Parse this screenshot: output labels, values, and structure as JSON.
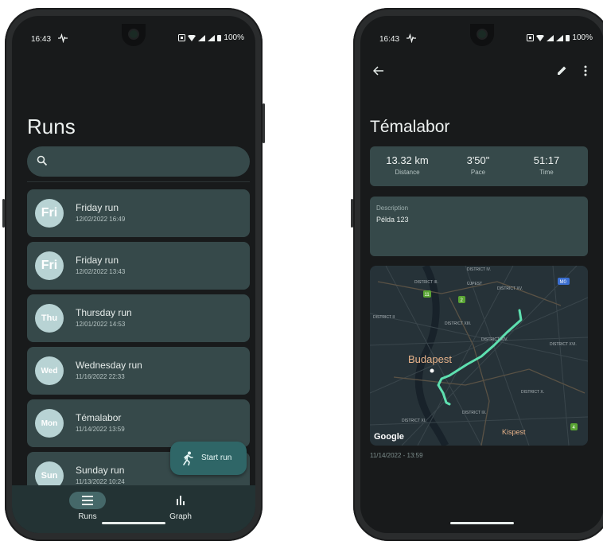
{
  "status_bar": {
    "time": "16:43",
    "battery": "100%"
  },
  "runs_screen": {
    "title": "Runs",
    "runs": [
      {
        "day": "Fri",
        "name": "Friday run",
        "date": "12/02/2022 16:49"
      },
      {
        "day": "Fri",
        "name": "Friday run",
        "date": "12/02/2022 13:43"
      },
      {
        "day": "Thu",
        "name": "Thursday run",
        "date": "12/01/2022 14:53"
      },
      {
        "day": "Wed",
        "name": "Wednesday run",
        "date": "11/16/2022 22:33"
      },
      {
        "day": "Mon",
        "name": "Témalabor",
        "date": "11/14/2022 13:59"
      },
      {
        "day": "Sun",
        "name": "Sunday run",
        "date": "11/13/2022 10:24"
      }
    ],
    "fab_label": "Start run",
    "nav": [
      {
        "label": "Runs",
        "icon": "list-icon",
        "active": true
      },
      {
        "label": "Graph",
        "icon": "bar-chart-icon",
        "active": false
      }
    ]
  },
  "detail_screen": {
    "title": "Témalabor",
    "stats": [
      {
        "value": "13.32 km",
        "label": "Distance"
      },
      {
        "value": "3'50\"",
        "label": "Pace"
      },
      {
        "value": "51:17",
        "label": "Time"
      }
    ],
    "description_label": "Description",
    "description_value": "Példa 123",
    "map": {
      "city_label": "Budapest",
      "districts": [
        "DISTRICT IV.",
        "DISTRICT III.",
        "ÚJPEST",
        "DISTRICT XV.",
        "DISTRICT II",
        "DISTRICT XIII.",
        "DISTRICT XIV.",
        "DISTRICT XVI.",
        "DISTRICT X.",
        "DISTRICT IX.",
        "DISTRICT XI.",
        "Kispest"
      ],
      "route_badges": [
        "M0",
        "11",
        "2",
        "4"
      ],
      "attribution": "Google"
    },
    "date_range": "11/14/2022 - 13:59"
  },
  "colors": {
    "background": "#181a1b",
    "card": "#36494a",
    "accent": "#2f6667",
    "route": "#5ee0b0"
  }
}
